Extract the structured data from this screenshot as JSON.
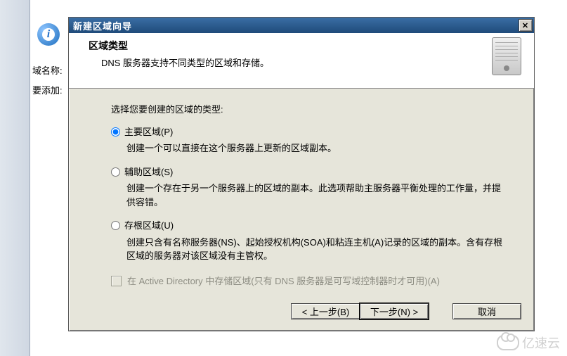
{
  "background": {
    "label_domain": "域名称:",
    "label_add": "要添加:"
  },
  "wizard": {
    "title": "新建区域向导",
    "close_glyph": "✕",
    "header_title": "区域类型",
    "header_sub": "DNS 服务器支持不同类型的区域和存储。",
    "prompt": "选择您要创建的区域的类型:",
    "options": [
      {
        "key": "primary",
        "label": "主要区域(P)",
        "desc": "创建一个可以直接在这个服务器上更新的区域副本。",
        "selected": true
      },
      {
        "key": "secondary",
        "label": "辅助区域(S)",
        "desc": "创建一个存在于另一个服务器上的区域的副本。此选项帮助主服务器平衡处理的工作量，并提供容错。",
        "selected": false
      },
      {
        "key": "stub",
        "label": "存根区域(U)",
        "desc": "创建只含有名称服务器(NS)、起始授权机构(SOA)和粘连主机(A)记录的区域的副本。含有存根区域的服务器对该区域没有主管权。",
        "selected": false
      }
    ],
    "ad_checkbox_label": "在 Active Directory 中存储区域(只有 DNS 服务器是可写域控制器时才可用)(A)",
    "buttons": {
      "back": "< 上一步(B)",
      "next": "下一步(N) >",
      "cancel": "取消"
    }
  },
  "watermark": "亿速云"
}
